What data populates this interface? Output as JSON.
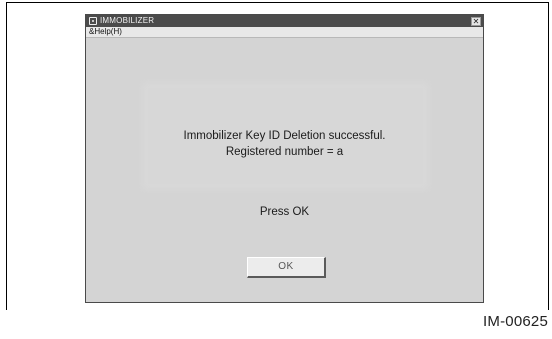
{
  "window": {
    "title": "IMMOBILIZER",
    "close_glyph": "✕",
    "app_icon": "app-icon"
  },
  "menubar": {
    "items": [
      {
        "label": "&Help(H)"
      }
    ]
  },
  "dialog": {
    "message_line1": "Immobilizer Key ID Deletion successful.",
    "message_line2": "Registered number = a",
    "prompt": "Press OK",
    "ok_label": "OK"
  },
  "figure": {
    "id": "IM-00625"
  },
  "colors": {
    "titlebar": "#4b4b4b",
    "client": "#d4d4d4",
    "button_face": "#ececec"
  }
}
